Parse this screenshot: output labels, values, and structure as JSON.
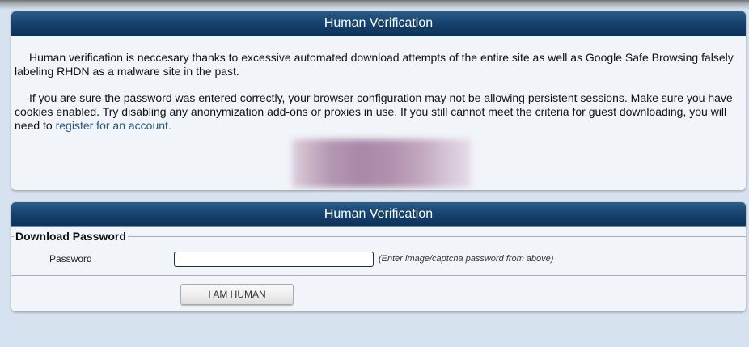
{
  "info_panel": {
    "title": "Human Verification",
    "paragraph_1": "Human verification is neccesary thanks to excessive automated download attempts of the entire site as well as Google Safe Browsing falsely labeling RHDN as a malware site in the past.",
    "paragraph_2_text": "If you are sure the password was entered correctly, your browser configuration may not be allowing persistent sessions. Make sure you have cookies enabled. Try disabling any anonymization add-ons or proxies in use. If you still cannot meet the criteria for guest downloading, you will need to ",
    "register_link": "register for an account."
  },
  "form_panel": {
    "title": "Human Verification",
    "legend": "Download Password",
    "password_label": "Password",
    "password_value": "",
    "password_hint": "(Enter image/captcha password from above)",
    "submit_label": "I AM HUMAN"
  },
  "colors": {
    "header_bg": "#174470",
    "panel_bg": "#f1f5f9",
    "page_bg": "#d6e2ef",
    "link": "#25567e"
  }
}
